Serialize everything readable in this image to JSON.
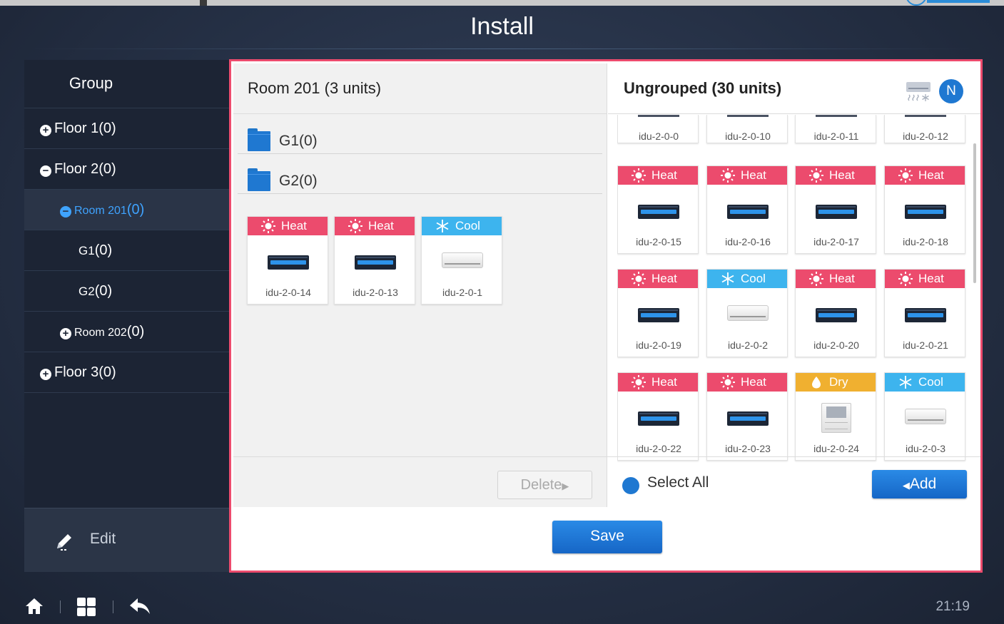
{
  "app": {
    "title": "Install",
    "time": "21:19"
  },
  "sidebar": {
    "header": "Group",
    "items": [
      {
        "label": "Floor 1",
        "count": "(0)",
        "icon": "plus-circle-icon"
      },
      {
        "label": "Floor 2",
        "count": "(0)",
        "icon": "minus-circle-icon"
      },
      {
        "label": "Room 201",
        "count": "(0)",
        "icon": "minus-circle-icon",
        "active": true
      },
      {
        "label": "G1",
        "count": "(0)"
      },
      {
        "label": "G2",
        "count": "(0)"
      },
      {
        "label": "Room 202",
        "count": "(0)",
        "icon": "plus-circle-icon"
      },
      {
        "label": "Floor 3",
        "count": "(0)",
        "icon": "plus-circle-icon"
      }
    ],
    "edit_label": "Edit"
  },
  "room": {
    "title": "Room 201 (3 units)",
    "folders": [
      "G1(0)",
      "G2(0)"
    ],
    "units": [
      {
        "mode": "Heat",
        "name": "idu-2-0-14",
        "type": "duct"
      },
      {
        "mode": "Heat",
        "name": "idu-2-0-13",
        "type": "duct"
      },
      {
        "mode": "Cool",
        "name": "idu-2-0-1",
        "type": "wall"
      }
    ],
    "delete_label": "Delete"
  },
  "ungrouped": {
    "title": "Ungrouped (30 units)",
    "badge": "N",
    "partial_row": [
      "idu-2-0-0",
      "idu-2-0-10",
      "idu-2-0-11",
      "idu-2-0-12"
    ],
    "units": [
      {
        "mode": "Heat",
        "name": "idu-2-0-15",
        "type": "duct"
      },
      {
        "mode": "Heat",
        "name": "idu-2-0-16",
        "type": "duct"
      },
      {
        "mode": "Heat",
        "name": "idu-2-0-17",
        "type": "duct"
      },
      {
        "mode": "Heat",
        "name": "idu-2-0-18",
        "type": "duct"
      },
      {
        "mode": "Heat",
        "name": "idu-2-0-19",
        "type": "duct"
      },
      {
        "mode": "Cool",
        "name": "idu-2-0-2",
        "type": "wall"
      },
      {
        "mode": "Heat",
        "name": "idu-2-0-20",
        "type": "duct"
      },
      {
        "mode": "Heat",
        "name": "idu-2-0-21",
        "type": "duct"
      },
      {
        "mode": "Heat",
        "name": "idu-2-0-22",
        "type": "duct"
      },
      {
        "mode": "Heat",
        "name": "idu-2-0-23",
        "type": "duct"
      },
      {
        "mode": "Dry",
        "name": "idu-2-0-24",
        "type": "controller"
      },
      {
        "mode": "Cool",
        "name": "idu-2-0-3",
        "type": "wall"
      }
    ],
    "select_all_label": "Select All",
    "add_label": "Add"
  },
  "save_label": "Save",
  "colors": {
    "heat": "#ec4b6d",
    "cool": "#3db4ee",
    "dry": "#f0b030",
    "accent": "#1f78d1",
    "frame": "#ec4b6d"
  }
}
